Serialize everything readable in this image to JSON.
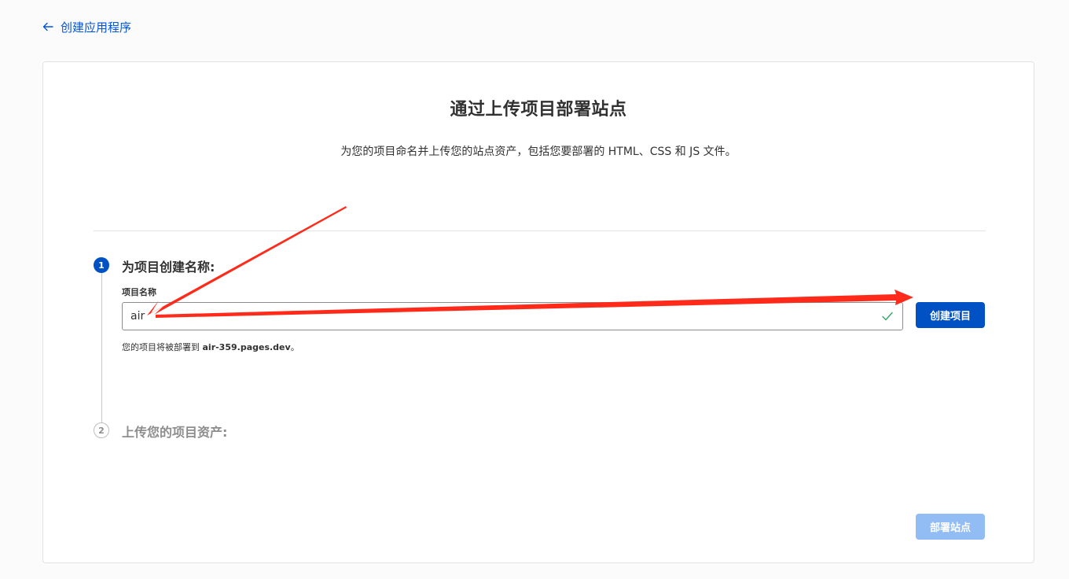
{
  "nav": {
    "back_label": "创建应用程序"
  },
  "header": {
    "title": "通过上传项目部署站点",
    "subtitle": "为您的项目命名并上传您的站点资产，包括您要部署的 HTML、CSS 和 JS 文件。"
  },
  "steps": [
    {
      "number": "1",
      "title": "为项目创建名称:",
      "field_label": "项目名称",
      "input_value": "air",
      "input_valid": true,
      "create_button": "创建项目",
      "hint_prefix": "您的项目将被部署到 ",
      "hint_domain": "air-359.pages.dev",
      "hint_suffix": "。"
    },
    {
      "number": "2",
      "title": "上传您的项目资产:"
    }
  ],
  "footer": {
    "deploy_button": "部署站点",
    "deploy_enabled": false
  },
  "colors": {
    "primary": "#0051c3",
    "link": "#0055dc",
    "disabled_button": "#92bcf4",
    "valid_check": "#3aa76d",
    "annotation_arrow": "#ff2a1a"
  }
}
